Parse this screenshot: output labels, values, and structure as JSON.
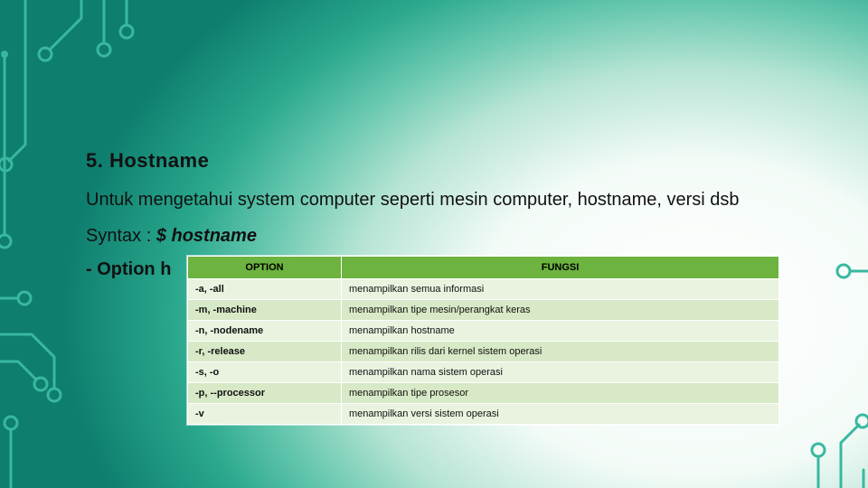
{
  "heading": "5. Hostname",
  "description": "Untuk mengetahui system computer seperti mesin computer, hostname, versi dsb",
  "syntax_label": "Syntax : ",
  "syntax_cmd": "$ hostname",
  "option_lead": "- Option h",
  "table": {
    "head_option": "OPTION",
    "head_fungsi": "FUNGSI",
    "rows": [
      {
        "option": "-a, -all",
        "fungsi": "menampilkan semua informasi"
      },
      {
        "option": "-m, -machine",
        "fungsi": "menampilkan tipe mesin/perangkat keras"
      },
      {
        "option": "-n, -nodename",
        "fungsi": "menampilkan hostname"
      },
      {
        "option": "-r, -release",
        "fungsi": "menampilkan rilis dari kernel sistem operasi"
      },
      {
        "option": "-s, -o",
        "fungsi": "menampilkan nama sistem operasi"
      },
      {
        "option": "-p, --processor",
        "fungsi": "menampilkan tipe prosesor"
      },
      {
        "option": "-v",
        "fungsi": "menampilkan versi sistem operasi"
      }
    ]
  }
}
